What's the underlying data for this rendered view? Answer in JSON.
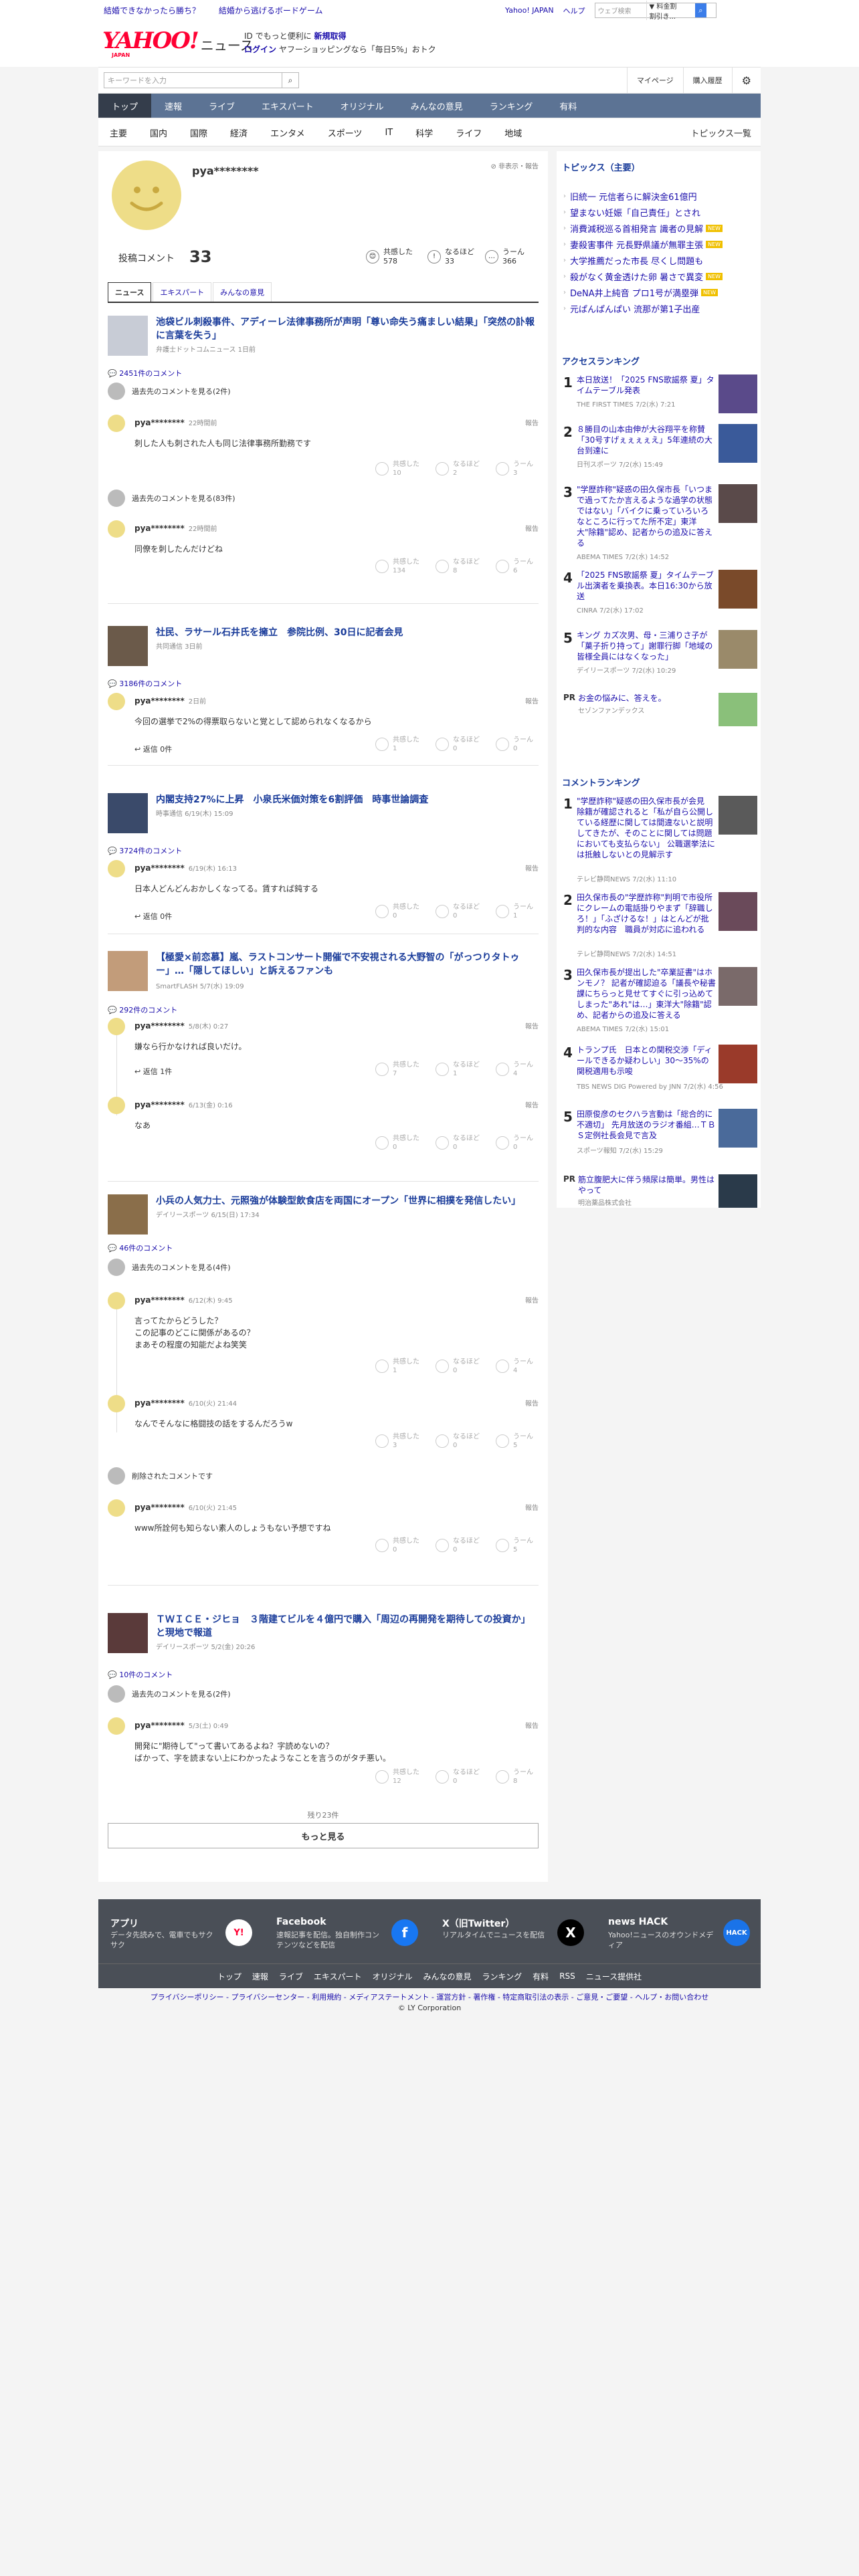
{
  "promo": {
    "left": [
      "結婚できなかったら勝ち？",
      "結婚から逃げるボードゲーム"
    ],
    "right": [
      "Yahoo! JAPAN",
      "ヘルプ"
    ],
    "search_placeholder": "ウェブ検索",
    "search_select": "▼ 料金割割引き..."
  },
  "header": {
    "logo": "YAHOO!",
    "logo_sub": "JAPAN",
    "brand": "ニュース",
    "msg1_pre": "ID でもっと便利に",
    "msg1_link": "新規取得",
    "msg2_link": "ログイン",
    "msg2_rest": " ヤフーショッピングなら「毎日5%」おトク"
  },
  "searchbar": {
    "placeholder": "キーワードを入力",
    "mypage": "マイページ",
    "history": "購入履歴"
  },
  "nav": [
    "トップ",
    "速報",
    "ライブ",
    "エキスパート",
    "オリジナル",
    "みんなの意見",
    "ランキング",
    "有料"
  ],
  "subnav": [
    "主要",
    "国内",
    "国際",
    "経済",
    "エンタメ",
    "スポーツ",
    "IT",
    "科学",
    "ライフ",
    "地域"
  ],
  "subnav_right": "トピックス一覧",
  "profile": {
    "name": "pya********",
    "options": "非表示・報告",
    "posts_label": "投稿コメント",
    "posts": "33",
    "reactions": [
      {
        "label": "共感した",
        "count": "578",
        "icon": "😊"
      },
      {
        "label": "なるほど",
        "count": "33",
        "icon": "!"
      },
      {
        "label": "うーん",
        "count": "366",
        "icon": "…"
      }
    ]
  },
  "tabs": [
    "ニュース",
    "エキスパート",
    "みんなの意見"
  ],
  "articles": [
    {
      "title": "池袋ビル刺殺事件、アディーレ法律事務所が声明「尊い命失う痛ましい結果」「突然の訃報に言葉を失う」",
      "source": "弁護士ドットコムニュース 1日前",
      "count": "2451件のコメント",
      "thumb": "#c8ccd6"
    },
    {
      "title": "社民、ラサール石井氏を擁立　参院比例、30日に記者会見",
      "source": "共同通信 3日前",
      "count": "3186件のコメント",
      "thumb": "#6b5a4a"
    },
    {
      "title": "内閣支持27%に上昇　小泉氏米価対策を6割評価　時事世論調査",
      "source": "時事通信 6/19(木) 15:09",
      "count": "3724件のコメント",
      "thumb": "#3a4a6a"
    },
    {
      "title": "【極愛×前恋慕】嵐、ラストコンサート開催で不安視される大野智の「がっつりタトゥー」…「隠してほしい」と訴えるファンも",
      "source": "SmartFLASH 5/7(水) 19:09",
      "count": "292件のコメント",
      "thumb": "#c29c7a"
    },
    {
      "title": "小兵の人気力士、元照強が体験型飲食店を両国にオープン「世界に相撲を発信したい」",
      "source": "デイリースポーツ 6/15(日) 17:34",
      "count": "46件のコメント",
      "thumb": "#8a6e4a"
    },
    {
      "title": "ＴＷＩＣＥ・ジヒョ　３階建てビルを４億円で購入「周辺の再開発を期待しての投資か」と現地で報道",
      "source": "デイリースポーツ 5/2(金) 20:26",
      "count": "10件のコメント",
      "thumb": "#5a3a3a"
    }
  ],
  "see_prev": [
    "過去先のコメントを見る(2件)",
    "過去先のコメントを見る(83件)",
    "過去先のコメントを見る(4件)",
    "過去先のコメントを見る(2件)"
  ],
  "comments": [
    {
      "name": "pya********",
      "time": "22時間前",
      "text": "刺した人も刺された人も同じ法律事務所勤務です",
      "r": [
        "10",
        "2",
        "3"
      ]
    },
    {
      "name": "pya********",
      "time": "22時間前",
      "text": "同僚を刺したんだけどね",
      "r": [
        "134",
        "8",
        "6"
      ]
    },
    {
      "name": "pya********",
      "time": "2日前",
      "text": "今回の選挙で2%の得票取らないと覚として認められなくなるから",
      "r": [
        "1",
        "0",
        "0"
      ]
    },
    {
      "name": "pya********",
      "time": "6/19(木) 16:13",
      "text": "日本人どんどんおかしくなってる。賃すれば鈍する",
      "r": [
        "0",
        "0",
        "1"
      ]
    },
    {
      "name": "pya********",
      "time": "5/8(木) 0:27",
      "text": "嫌なら行かなければ良いだけ。",
      "r": [
        "7",
        "1",
        "4"
      ]
    },
    {
      "name": "pya********",
      "time": "6/13(金) 0:16",
      "text": "なあ",
      "r": [
        "0",
        "0",
        "0"
      ]
    },
    {
      "name": "pya********",
      "time": "6/12(木) 9:45",
      "text": "言ってたからどうした？\nこの記事のどこに関係があるの？\nまあその程度の知能だよね笑笑",
      "r": [
        "1",
        "0",
        "4"
      ]
    },
    {
      "name": "pya********",
      "time": "6/10(火) 21:44",
      "text": "なんでそんなに格闘技の話をするんだろうw",
      "r": [
        "3",
        "0",
        "5"
      ]
    },
    {
      "name": "pya********",
      "time": "6/10(火) 21:45",
      "text": "www所詮何も知らない素人のしょうもない予想ですね",
      "r": [
        "0",
        "0",
        "5"
      ]
    },
    {
      "name": "pya********",
      "time": "5/3(土) 0:49",
      "text": "開発に\"期待して\"って書いてあるよね？字読めないの？\nばかって、字を読まない上にわかったようなことを言うのがタチ悪い。",
      "r": [
        "12",
        "0",
        "8"
      ]
    }
  ],
  "replies": [
    "返信 0件",
    "返信 0件",
    "返信 1件"
  ],
  "deleted": "削除されたコメントです",
  "report": "報告",
  "reaction_labels": [
    "共感した",
    "なるほど",
    "うーん"
  ],
  "more": {
    "remaining": "残り23件",
    "button": "もっと見る"
  },
  "sidebar": {
    "topics_title": "トピックス（主要）",
    "topics": [
      {
        "t": "旧統一 元信者らに解決金61億円",
        "new": false
      },
      {
        "t": "望まない妊娠「自己責任」とされ",
        "new": false
      },
      {
        "t": "消費減税巡る首相発言 識者の見解",
        "new": true
      },
      {
        "t": "妻殺害事件 元長野県議が無罪主張",
        "new": true
      },
      {
        "t": "大学推薦だった市長 尽くし問題も",
        "new": false
      },
      {
        "t": "殺がなく黄金透けた卵 暑さで異変",
        "new": true
      },
      {
        "t": "DeNA井上純音 プロ1号が満塁弾",
        "new": true
      },
      {
        "t": "元ぱんぱんぱい 流那が第1子出産",
        "new": false
      }
    ],
    "new_label": "NEW",
    "access_title": "アクセスランキング",
    "access": [
      {
        "n": "1",
        "t": "本日放送！「2025 FNS歌謡祭 夏」タイムテーブル発表",
        "s": "THE FIRST TIMES 7/2(水) 7:21",
        "c": "#5a4a8a"
      },
      {
        "n": "2",
        "t": "８勝目の山本由伸が大谷翔平を称賛「30号すげぇぇぇぇえ」5年連続の大台到達に",
        "s": "日刊スポーツ 7/2(水) 15:49",
        "c": "#3a5a9a"
      },
      {
        "n": "3",
        "t": "\"学歴詐称\"疑惑の田久保市長「いつまで過ってたか言えるような過学の状態ではない」「バイクに乗っていろいろなところに行ってた所不定」東洋大\"除籍\"認め、記者からの追及に答える",
        "s": "ABEMA TIMES 7/2(水) 14:52",
        "c": "#5a4a4a"
      },
      {
        "n": "4",
        "t": "「2025 FNS歌謡祭 夏」タイムテーブル出演者を乗換表。本日16:30から放送",
        "s": "CINRA 7/2(水) 17:02",
        "c": "#7a4a2a"
      },
      {
        "n": "5",
        "t": "キング カズ次男、母・三浦りさ子が「菓子折り持って」謝罪行脚「地域の皆様全員にはなくなった」",
        "s": "デイリースポーツ 7/2(水) 10:29",
        "c": "#9a8a6a"
      }
    ],
    "pr1": {
      "lab": "PR",
      "t": "お金の悩みに、答えを。",
      "s": "セゾンファンデックス"
    },
    "comment_title": "コメントランキング",
    "comment": [
      {
        "n": "1",
        "t": "\"学歴詐称\"疑惑の田久保市長が会見　除籍が確認されると「私が自ら公開している経歴に関しては間違ないと説明してきたが、そのことに関しては問題においても支払らない」 公職選挙法には抵触しないとの見解示す",
        "s": "テレビ静岡NEWS 7/2(水) 11:10",
        "c": "#5a5a5a"
      },
      {
        "n": "2",
        "t": "田久保市長の\"学歴詐称\"判明で市役所にクレームの電話掛りやまず「辞職しろ！」「ふざけるな！」はとんどが批判的な内容　職員が対応に追われる",
        "s": "テレビ静岡NEWS 7/2(水) 14:51",
        "c": "#6a4a5a"
      },
      {
        "n": "3",
        "t": "田久保市長が提出した\"卒業証書\"はホンモノ？ 記者が確認迫る「議長や秘書課にちらっと見せてすぐに引っ込めてしまった\"あれ\"は…」東洋大\"除籍\"認め、記者からの追及に答える",
        "s": "ABEMA TIMES 7/2(水) 15:01",
        "c": "#7a6a6a"
      },
      {
        "n": "4",
        "t": "トランプ氏　日本との関税交渉「ディールできるか疑わしい」30～35%の関税適用も示唆",
        "s": "TBS NEWS DIG Powered by JNN 7/2(水) 4:56",
        "c": "#9a3a2a"
      },
      {
        "n": "5",
        "t": "田原俊彦のセクハラ言動は「総合的に不適切」 先月放送のラジオ番組…ＴＢＳ定例社長会見で言及",
        "s": "スポーツ報知 7/2(水) 15:29",
        "c": "#4a6a9a"
      }
    ],
    "pr2": {
      "lab": "PR",
      "t": "筋立腹肥大に伴う頻尿は簡単。男性はやって",
      "s": "明治薬品株式会社"
    }
  },
  "apps": [
    {
      "h": "アプリ",
      "d": "データ先読みで、電車でもサクサク",
      "icon": "Y!",
      "c": "#fff",
      "fg": "#ff0033"
    },
    {
      "h": "Facebook",
      "d": "速報記事を配信。独自制作コンテンツなどを配信",
      "icon": "f",
      "c": "#1877f2",
      "fg": "#fff"
    },
    {
      "h": "X（旧Twitter）",
      "d": "リアルタイムでニュースを配信",
      "icon": "X",
      "c": "#000",
      "fg": "#fff"
    },
    {
      "h": "news HACK",
      "d": "Yahoo!ニュースのオウンドメディア",
      "icon": "HACK",
      "c": "#1a73e8",
      "fg": "#fff"
    }
  ],
  "footer_nav": [
    "トップ",
    "速報",
    "ライブ",
    "エキスパート",
    "オリジナル",
    "みんなの意見",
    "ランキング",
    "有料",
    "RSS",
    "ニュース提供社"
  ],
  "footer_links": "プライバシーポリシー - プライバシーセンター - 利用規約 - メディアステートメント - 運営方針 - 著作権 - 特定商取引法の表示 - ご意見・ご要望 - ヘルプ・お問い合わせ",
  "copyright": "© LY Corporation"
}
